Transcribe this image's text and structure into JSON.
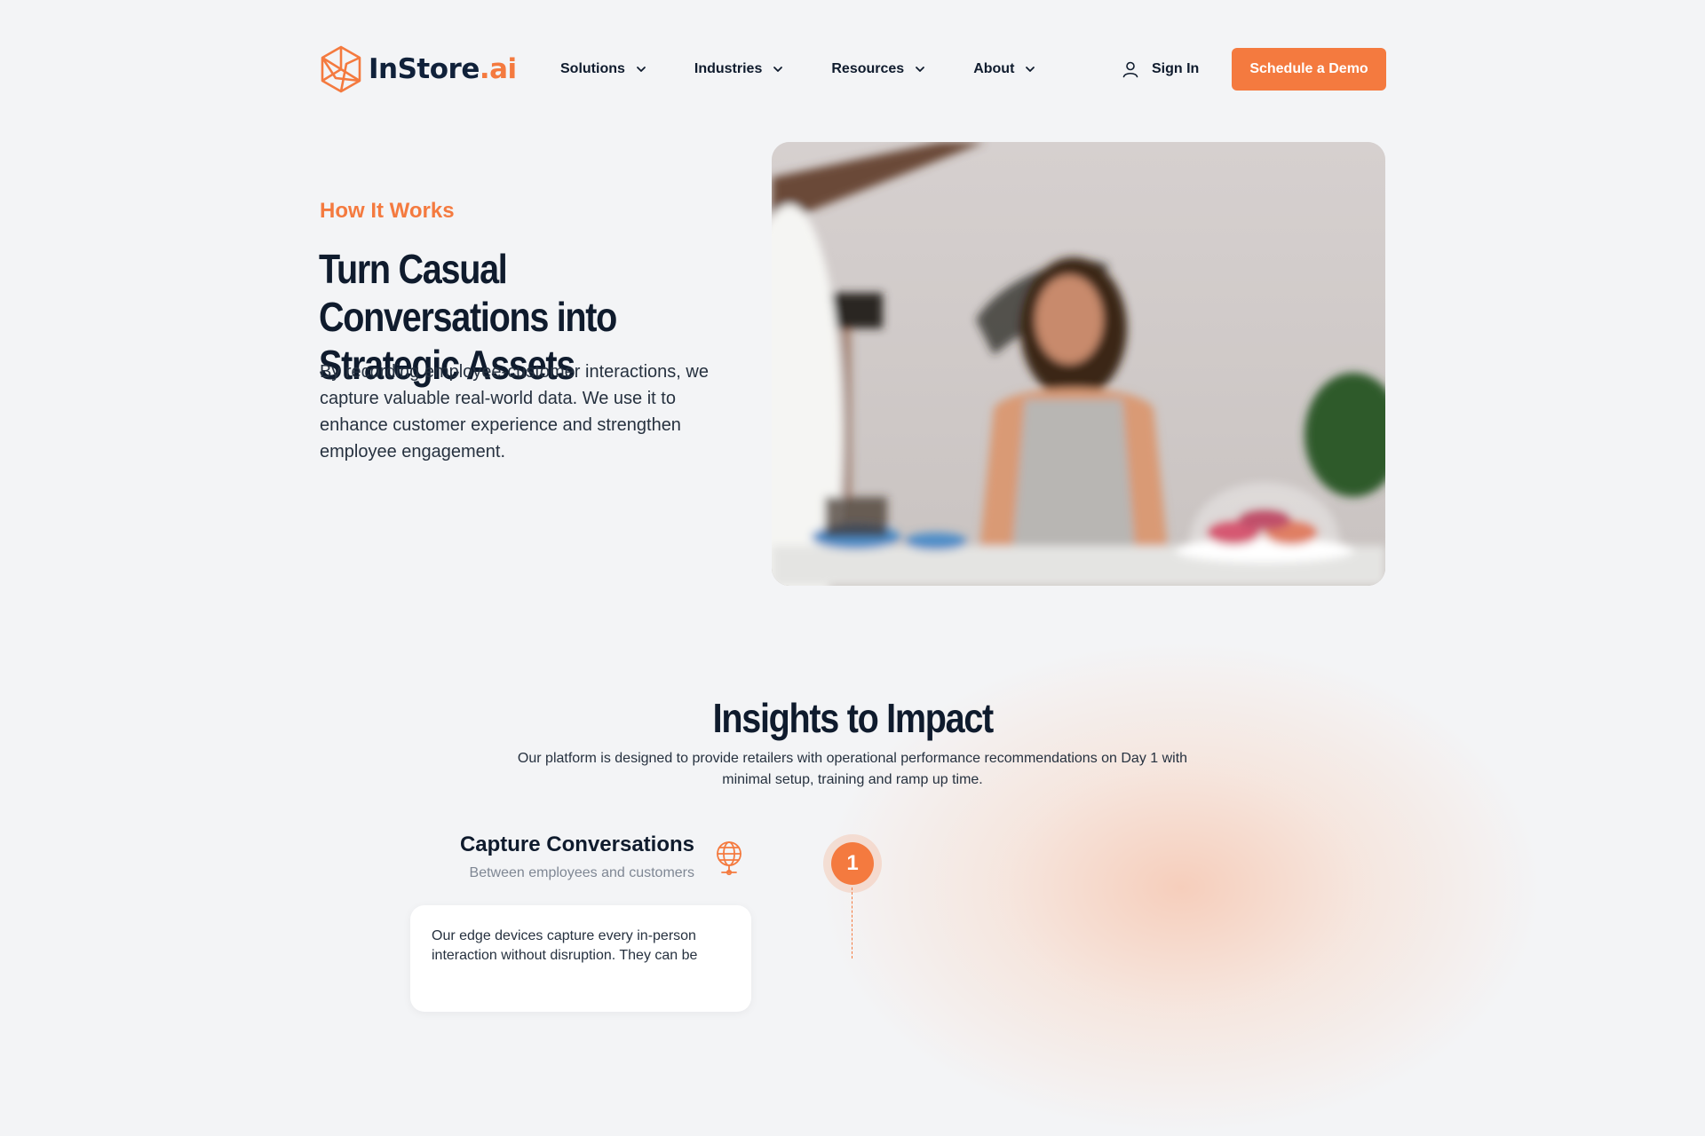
{
  "brand": {
    "name_main": "InStore",
    "name_accent": ".ai",
    "accent_color": "#f47a3f",
    "dark_color": "#10213a",
    "icon": "hexagon-network-logo-icon"
  },
  "nav": {
    "items": [
      {
        "label": "Solutions",
        "icon": "chevron-down-icon"
      },
      {
        "label": "Industries",
        "icon": "chevron-down-icon"
      },
      {
        "label": "Resources",
        "icon": "chevron-down-icon"
      },
      {
        "label": "About",
        "icon": "chevron-down-icon"
      }
    ],
    "sign_in": {
      "label": "Sign In",
      "icon": "user-icon"
    },
    "cta": "Schedule a Demo"
  },
  "hero": {
    "eyebrow": "How It Works",
    "title": "Turn Casual Conversations into Strategic Assets",
    "text": "By recording employee-customer interactions, we capture valuable real-world data. We use it to enhance customer experience and strengthen employee engagement."
  },
  "insights": {
    "title": "Insights to Impact",
    "subtitle": "Our platform is designed to provide retailers with operational performance recommendations on Day 1 with minimal setup, training and ramp up time.",
    "steps": [
      {
        "number": "1",
        "title": "Capture Conversations",
        "subtitle": "Between employees and customers",
        "icon": "globe-pin-icon",
        "text": "Our edge devices capture every in-person interaction without disruption. They can be"
      }
    ]
  }
}
